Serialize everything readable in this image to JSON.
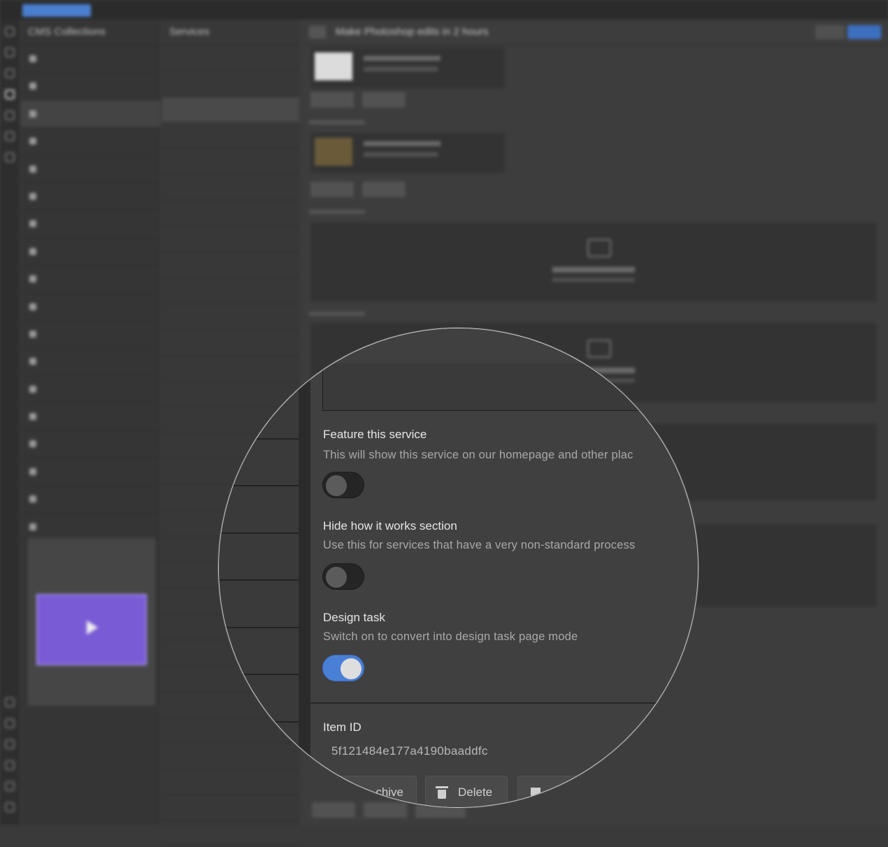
{
  "app": {
    "collections_title": "CMS Collections",
    "items_title": "Services",
    "item_title": "Make Photoshop edits in 2 hours"
  },
  "fields": {
    "feature": {
      "label": "Feature this service",
      "help": "This will show this service on our homepage and other plac",
      "on": false
    },
    "hide_how": {
      "label": "Hide how it works section",
      "help": "Use this for services that have a very non-standard process",
      "on": false
    },
    "design_task": {
      "label": "Design task",
      "help": "Switch on to convert into design task page mode",
      "on": true
    }
  },
  "item_id": {
    "label": "Item ID",
    "value": "5f121484e177a4190baaddfc"
  },
  "actions": {
    "archive_label": "chive",
    "delete_label": "Delete"
  },
  "colors": {
    "toggle_on": "#4a7fd6",
    "toggle_off": "#252525",
    "background": "#3d3d3d"
  }
}
